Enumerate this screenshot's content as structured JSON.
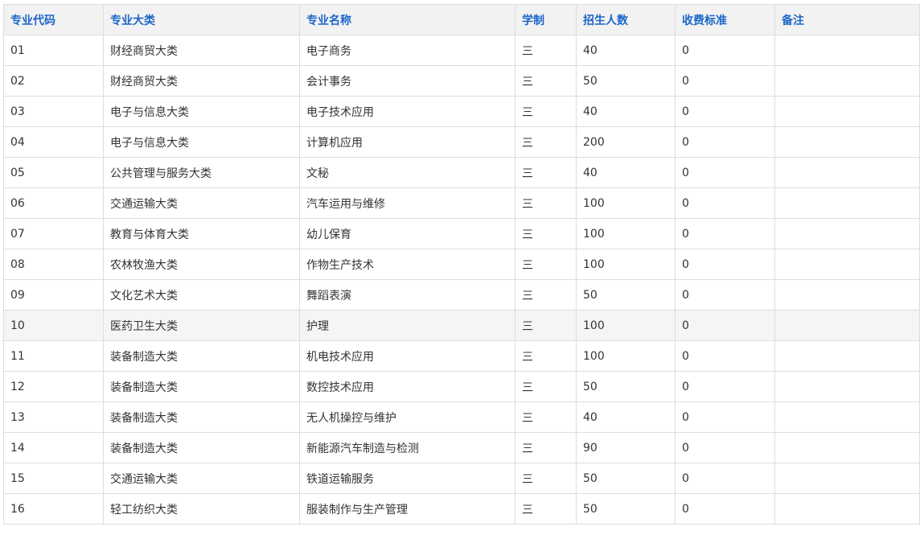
{
  "table": {
    "headers": [
      "专业代码",
      "专业大类",
      "专业名称",
      "学制",
      "招生人数",
      "收费标准",
      "备注"
    ],
    "rows": [
      [
        "01",
        "财经商贸大类",
        "电子商务",
        "三",
        "40",
        "0",
        ""
      ],
      [
        "02",
        "财经商贸大类",
        "会计事务",
        "三",
        "50",
        "0",
        ""
      ],
      [
        "03",
        "电子与信息大类",
        "电子技术应用",
        "三",
        "40",
        "0",
        ""
      ],
      [
        "04",
        "电子与信息大类",
        "计算机应用",
        "三",
        "200",
        "0",
        ""
      ],
      [
        "05",
        "公共管理与服务大类",
        "文秘",
        "三",
        "40",
        "0",
        ""
      ],
      [
        "06",
        "交通运输大类",
        "汽车运用与维修",
        "三",
        "100",
        "0",
        ""
      ],
      [
        "07",
        "教育与体育大类",
        "幼儿保育",
        "三",
        "100",
        "0",
        ""
      ],
      [
        "08",
        "农林牧渔大类",
        "作物生产技术",
        "三",
        "100",
        "0",
        ""
      ],
      [
        "09",
        "文化艺术大类",
        "舞蹈表演",
        "三",
        "50",
        "0",
        ""
      ],
      [
        "10",
        "医药卫生大类",
        "护理",
        "三",
        "100",
        "0",
        ""
      ],
      [
        "11",
        "装备制造大类",
        "机电技术应用",
        "三",
        "100",
        "0",
        ""
      ],
      [
        "12",
        "装备制造大类",
        "数控技术应用",
        "三",
        "50",
        "0",
        ""
      ],
      [
        "13",
        "装备制造大类",
        "无人机操控与维护",
        "三",
        "40",
        "0",
        ""
      ],
      [
        "14",
        "装备制造大类",
        "新能源汽车制造与检测",
        "三",
        "90",
        "0",
        ""
      ],
      [
        "15",
        "交通运输大类",
        "铁道运输服务",
        "三",
        "50",
        "0",
        ""
      ],
      [
        "16",
        "轻工纺织大类",
        "服装制作与生产管理",
        "三",
        "50",
        "0",
        ""
      ]
    ],
    "highlighted_row": 9
  }
}
